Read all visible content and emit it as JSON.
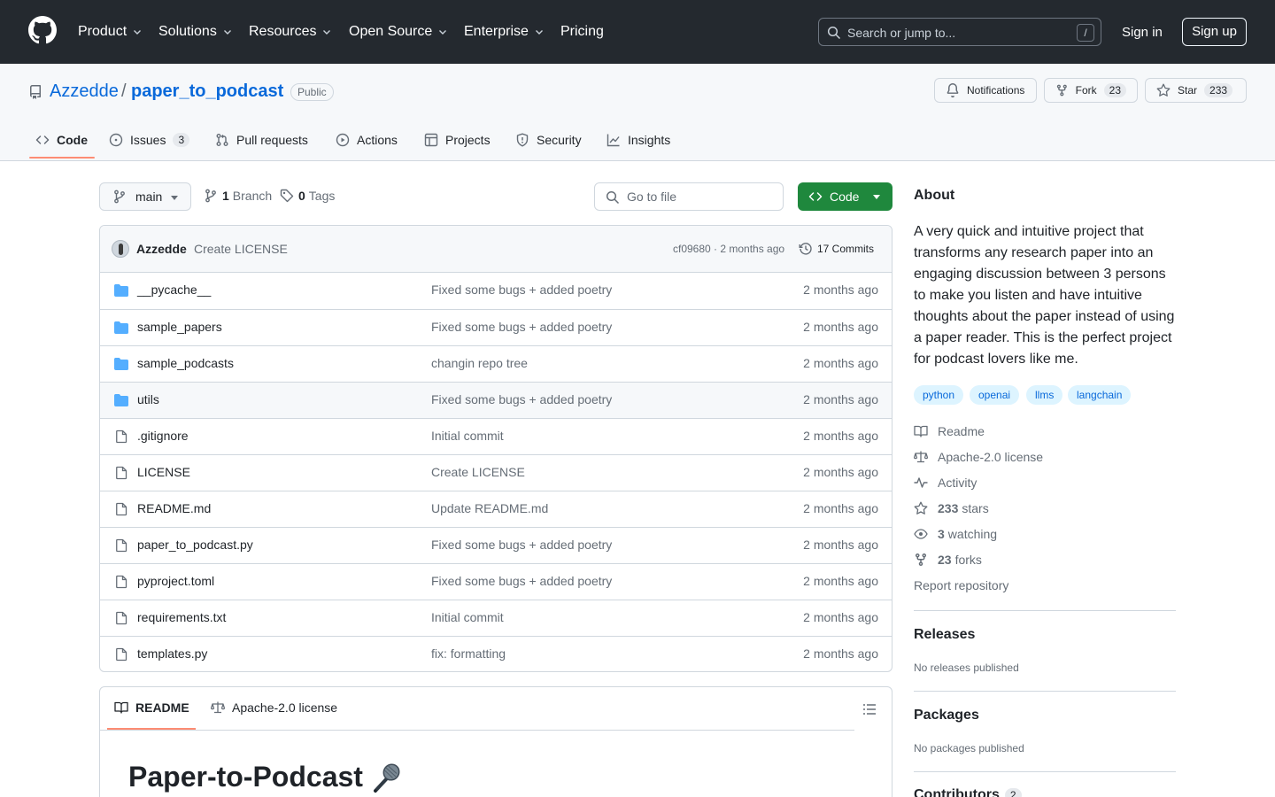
{
  "header": {
    "nav": [
      {
        "label": "Product"
      },
      {
        "label": "Solutions"
      },
      {
        "label": "Resources"
      },
      {
        "label": "Open Source"
      },
      {
        "label": "Enterprise"
      },
      {
        "label": "Pricing"
      }
    ],
    "search_placeholder": "Search or jump to...",
    "search_shortcut": "/",
    "sign_in": "Sign in",
    "sign_up": "Sign up"
  },
  "repo": {
    "owner": "Azzedde",
    "separator": "/",
    "name": "paper_to_podcast",
    "visibility": "Public",
    "notifications_label": "Notifications",
    "fork_label": "Fork",
    "fork_count": "23",
    "star_label": "Star",
    "star_count": "233"
  },
  "tabs": [
    {
      "label": "Code"
    },
    {
      "label": "Issues",
      "count": "3"
    },
    {
      "label": "Pull requests"
    },
    {
      "label": "Actions"
    },
    {
      "label": "Projects"
    },
    {
      "label": "Security"
    },
    {
      "label": "Insights"
    }
  ],
  "toolbar": {
    "branch": "main",
    "branches_count": "1",
    "branches_label": "Branch",
    "tags_count": "0",
    "tags_label": "Tags",
    "go_to_file": "Go to file",
    "code_button": "Code"
  },
  "latest_commit": {
    "author": "Azzedde",
    "message": "Create LICENSE",
    "hash_time": "cf09680 · 2 months ago",
    "commits": "17 Commits"
  },
  "files": [
    {
      "type": "dir",
      "name": "__pycache__",
      "message": "Fixed some bugs + added poetry",
      "time": "2 months ago"
    },
    {
      "type": "dir",
      "name": "sample_papers",
      "message": "Fixed some bugs + added poetry",
      "time": "2 months ago"
    },
    {
      "type": "dir",
      "name": "sample_podcasts",
      "message": "changin repo tree",
      "time": "2 months ago"
    },
    {
      "type": "dir",
      "name": "utils",
      "message": "Fixed some bugs + added poetry",
      "time": "2 months ago"
    },
    {
      "type": "file",
      "name": ".gitignore",
      "message": "Initial commit",
      "time": "2 months ago"
    },
    {
      "type": "file",
      "name": "LICENSE",
      "message": "Create LICENSE",
      "time": "2 months ago"
    },
    {
      "type": "file",
      "name": "README.md",
      "message": "Update README.md",
      "time": "2 months ago"
    },
    {
      "type": "file",
      "name": "paper_to_podcast.py",
      "message": "Fixed some bugs + added poetry",
      "time": "2 months ago"
    },
    {
      "type": "file",
      "name": "pyproject.toml",
      "message": "Fixed some bugs + added poetry",
      "time": "2 months ago"
    },
    {
      "type": "file",
      "name": "requirements.txt",
      "message": "Initial commit",
      "time": "2 months ago"
    },
    {
      "type": "file",
      "name": "templates.py",
      "message": "fix: formatting",
      "time": "2 months ago"
    }
  ],
  "readme": {
    "tab_readme": "README",
    "tab_license": "Apache-2.0 license",
    "title": "Paper-to-Podcast"
  },
  "sidebar": {
    "about_heading": "About",
    "description": "A very quick and intuitive project that transforms any research paper into an engaging discussion between 3 persons to make you listen and have intuitive thoughts about the paper instead of using a paper reader. This is the perfect project for podcast lovers like me.",
    "topics": [
      "python",
      "openai",
      "llms",
      "langchain"
    ],
    "readme": "Readme",
    "license": "Apache-2.0 license",
    "activity": "Activity",
    "stars_count": "233",
    "stars_label": "stars",
    "watching_count": "3",
    "watching_label": "watching",
    "forks_count": "23",
    "forks_label": "forks",
    "report": "Report repository",
    "releases_heading": "Releases",
    "releases_text": "No releases published",
    "packages_heading": "Packages",
    "packages_text": "No packages published",
    "contributors_heading": "Contributors",
    "contributors_count": "2"
  },
  "colors": {
    "header_bg": "#24292f",
    "link": "#0969da",
    "primary_button": "#1f883d",
    "folder": "#54aeff",
    "tab_underline": "#fd8c73"
  }
}
